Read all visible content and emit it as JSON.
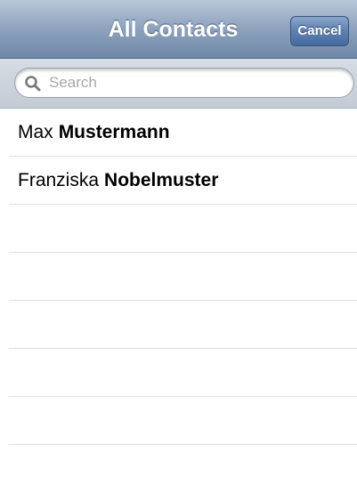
{
  "nav": {
    "title": "All Contacts",
    "cancel_label": "Cancel"
  },
  "search": {
    "placeholder": "Search",
    "value": ""
  },
  "contacts": [
    {
      "first": "Max",
      "last": "Mustermann"
    },
    {
      "first": "Franziska",
      "last": "Nobelmuster"
    }
  ],
  "empty_rows": 5,
  "colors": {
    "nav_bar": "#8ea2bd",
    "cancel_button": "#5d80b0",
    "separator": "#e0e0e0"
  },
  "icons": {
    "search": "search-icon"
  }
}
